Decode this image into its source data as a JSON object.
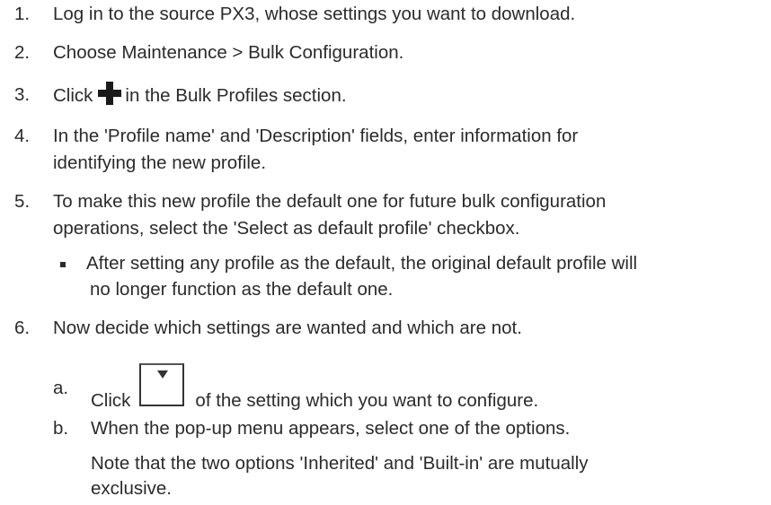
{
  "steps": {
    "s1": {
      "num": "1.",
      "text": "Log in to the source PX3, whose settings you want to download."
    },
    "s2": {
      "num": "2.",
      "text": "Choose Maintenance > Bulk Configuration."
    },
    "s3": {
      "num": "3.",
      "pre": "Click",
      "post": "in the Bulk Profiles section.",
      "icon": "plus-icon"
    },
    "s4": {
      "num": "4.",
      "line1": "In the 'Profile name' and 'Description' fields, enter information for",
      "line2": "identifying the new profile."
    },
    "s5": {
      "num": "5.",
      "line1": "To make this new profile the default one for future bulk configuration",
      "line2": "operations, select the 'Select as default profile' checkbox."
    },
    "s5_note": {
      "line1": "After setting any profile as the default, the original default profile will",
      "line2": "no longer function as the default one."
    },
    "s6": {
      "num": "6.",
      "text": "Now decide which settings are wanted and which are not."
    },
    "s6a": {
      "letter": "a.",
      "pre": "Click",
      "post": "of the setting which you want to configure.",
      "icon": "dropdown-arrow-icon"
    },
    "s6b": {
      "letter": "b.",
      "text": "When the pop-up menu appears, select one of the options."
    },
    "s6b_note": {
      "line1": "Note that the two options 'Inherited' and 'Built-in' are mutually",
      "line2": "exclusive."
    }
  },
  "colors": {
    "text": "#2b2b2b",
    "icon": "#1a1a1a"
  }
}
